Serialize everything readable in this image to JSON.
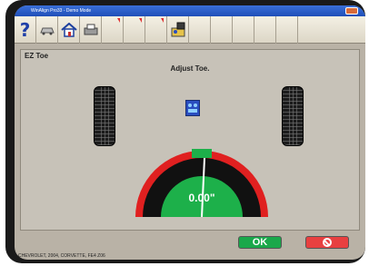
{
  "window": {
    "title": "WinAlign Pro33 - Demo Mode"
  },
  "toolbar": {
    "buttons": [
      {
        "icon": "help-icon",
        "glyph": "?"
      },
      {
        "icon": "vehicle-icon"
      },
      {
        "icon": "home-icon"
      },
      {
        "icon": "print-icon"
      },
      {
        "icon": "empty-slot-1"
      },
      {
        "icon": "empty-slot-2"
      },
      {
        "icon": "empty-slot-3"
      },
      {
        "icon": "measure-icon"
      }
    ]
  },
  "panel": {
    "title": "EZ Toe",
    "subtitle": "Adjust Toe."
  },
  "gauge": {
    "value": "0.00\"",
    "colors": {
      "ring": "#e02020",
      "track": "#111111",
      "fill": "#1db04a",
      "target": "#1db04a"
    }
  },
  "buttons": {
    "ok_label": "OK"
  },
  "status": {
    "vehicle": "CHEVROLET, 2004, CORVETTE, FE4 Z06"
  }
}
